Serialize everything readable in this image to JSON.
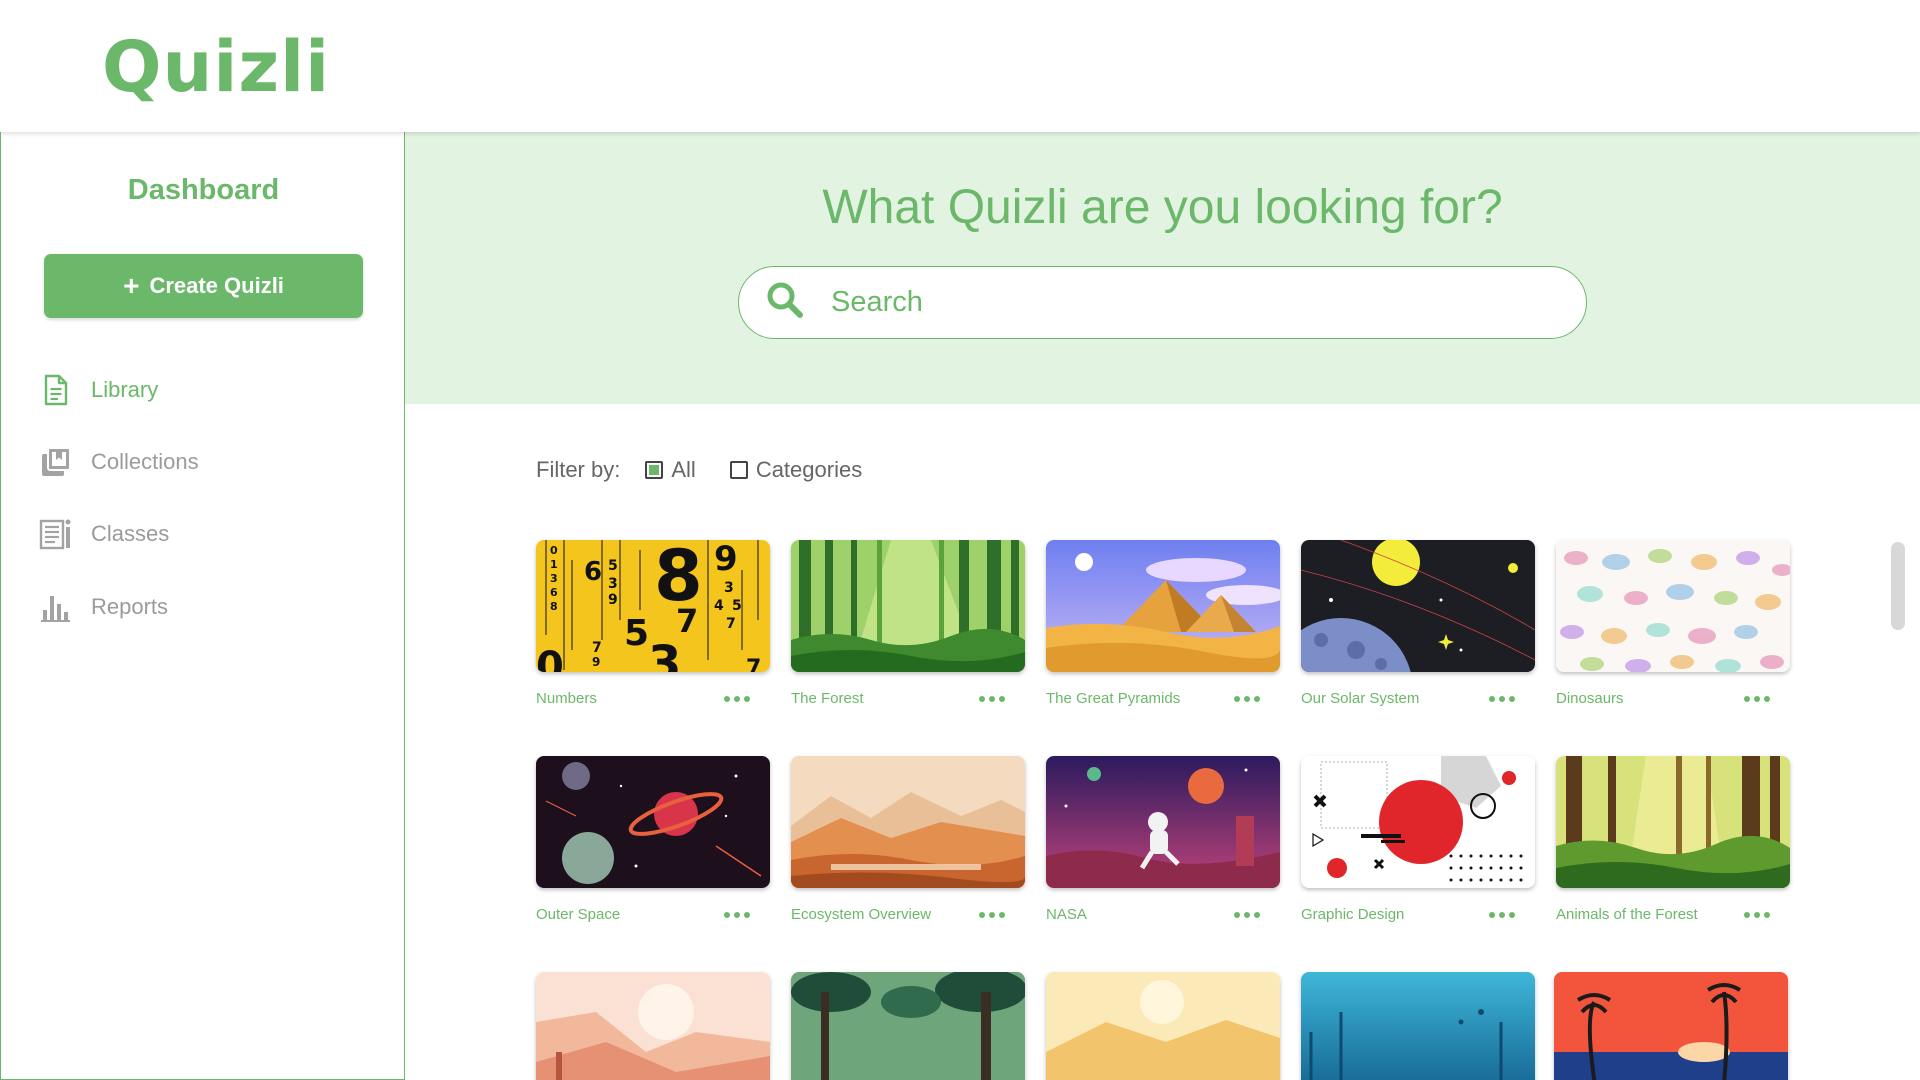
{
  "app": {
    "logo": "Quizli"
  },
  "sidebar": {
    "title": "Dashboard",
    "create_button": {
      "icon": "plus-icon",
      "label": "Create Quizli"
    },
    "items": [
      {
        "label": "Library",
        "icon": "document-icon",
        "active": true
      },
      {
        "label": "Collections",
        "icon": "collections-icon",
        "active": false
      },
      {
        "label": "Classes",
        "icon": "classes-icon",
        "active": false
      },
      {
        "label": "Reports",
        "icon": "bar-chart-icon",
        "active": false
      }
    ]
  },
  "hero": {
    "title": "What Quizli are you looking for?",
    "search": {
      "placeholder": "Search",
      "icon": "search-icon"
    }
  },
  "filter": {
    "label": "Filter by:",
    "options": [
      {
        "label": "All",
        "checked": true
      },
      {
        "label": "Categories",
        "checked": false
      }
    ]
  },
  "quizzes": [
    {
      "title": "Numbers",
      "thumb": "numbers"
    },
    {
      "title": "The Forest",
      "thumb": "forest"
    },
    {
      "title": "The Great Pyramids",
      "thumb": "pyramids"
    },
    {
      "title": "Our Solar System",
      "thumb": "solar"
    },
    {
      "title": "Dinosaurs",
      "thumb": "dinos"
    },
    {
      "title": "Outer Space",
      "thumb": "space"
    },
    {
      "title": "Ecosystem Overview",
      "thumb": "ecosystem"
    },
    {
      "title": "NASA",
      "thumb": "nasa"
    },
    {
      "title": "Graphic Design",
      "thumb": "graphic"
    },
    {
      "title": "Animals of the Forest",
      "thumb": "animals"
    },
    {
      "title": "",
      "thumb": "desert"
    },
    {
      "title": "",
      "thumb": "jungle"
    },
    {
      "title": "",
      "thumb": "dunes"
    },
    {
      "title": "",
      "thumb": "ocean"
    },
    {
      "title": "",
      "thumb": "sunset"
    }
  ],
  "colors": {
    "brand": "#6cb86a",
    "hero_bg": "#e3f3e2",
    "muted": "#9b9b9b"
  }
}
